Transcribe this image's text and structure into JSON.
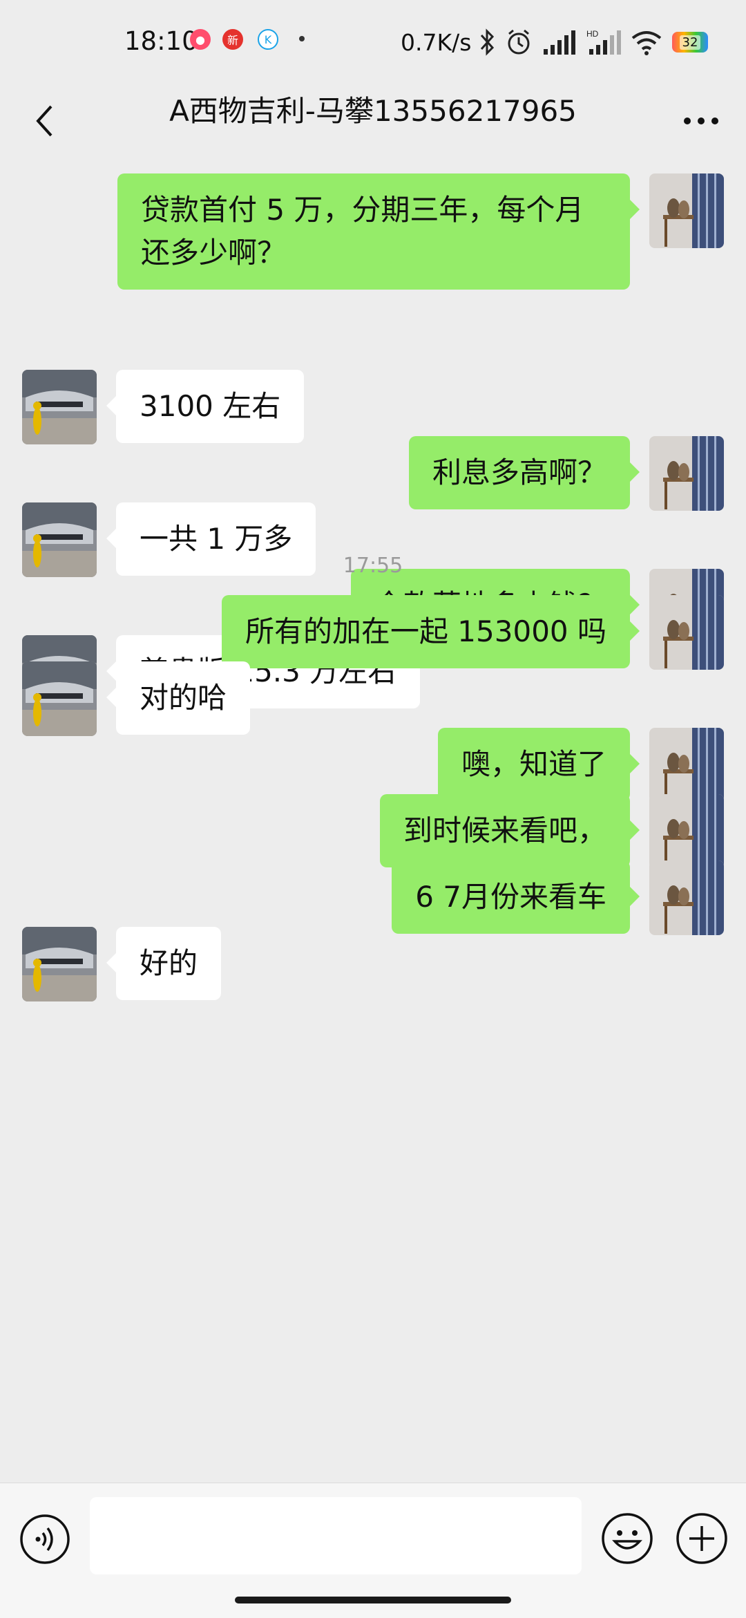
{
  "status_bar": {
    "time": "18:10",
    "network_speed": "0.7K/s",
    "app_icons": [
      "app-icon-1",
      "app-icon-news",
      "app-icon-k"
    ],
    "right_icons": [
      "bluetooth-icon",
      "alarm-icon",
      "signal-icon",
      "hd-signal-icon",
      "wifi-icon",
      "battery-icon"
    ],
    "battery_level": "32"
  },
  "header": {
    "title": "A西物吉利-马攀13556217965"
  },
  "messages": [
    {
      "sender": "me",
      "lines": [
        "贷款首付 5 万，分期三年，每个月",
        "还多少啊？"
      ]
    },
    {
      "sender": "them",
      "lines": [
        "3100 左右"
      ]
    },
    {
      "sender": "me",
      "lines": [
        "利息多高啊？"
      ]
    },
    {
      "sender": "them",
      "lines": [
        "一共 1 万多"
      ]
    },
    {
      "sender": "me",
      "lines": [
        "全款落地多少钱？"
      ]
    },
    {
      "sender": "them",
      "lines": [
        "尊贵版 15.3 万左右"
      ]
    },
    {
      "timestamp": "17:55"
    },
    {
      "sender": "me",
      "lines": [
        "所有的加在一起 153000 吗"
      ]
    },
    {
      "sender": "them",
      "lines": [
        "对的哈"
      ]
    },
    {
      "sender": "me",
      "lines": [
        "噢，知道了"
      ]
    },
    {
      "sender": "me",
      "lines": [
        "到时候来看吧，"
      ]
    },
    {
      "sender": "me",
      "lines": [
        "6 7月份来看车"
      ]
    },
    {
      "sender": "them",
      "lines": [
        "好的"
      ]
    }
  ],
  "input_bar": {
    "placeholder": "",
    "icons": [
      "voice-icon",
      "emoji-icon",
      "plus-icon"
    ]
  },
  "colors": {
    "background": "#ededed",
    "my_bubble": "#95ec69",
    "their_bubble": "#ffffff"
  }
}
